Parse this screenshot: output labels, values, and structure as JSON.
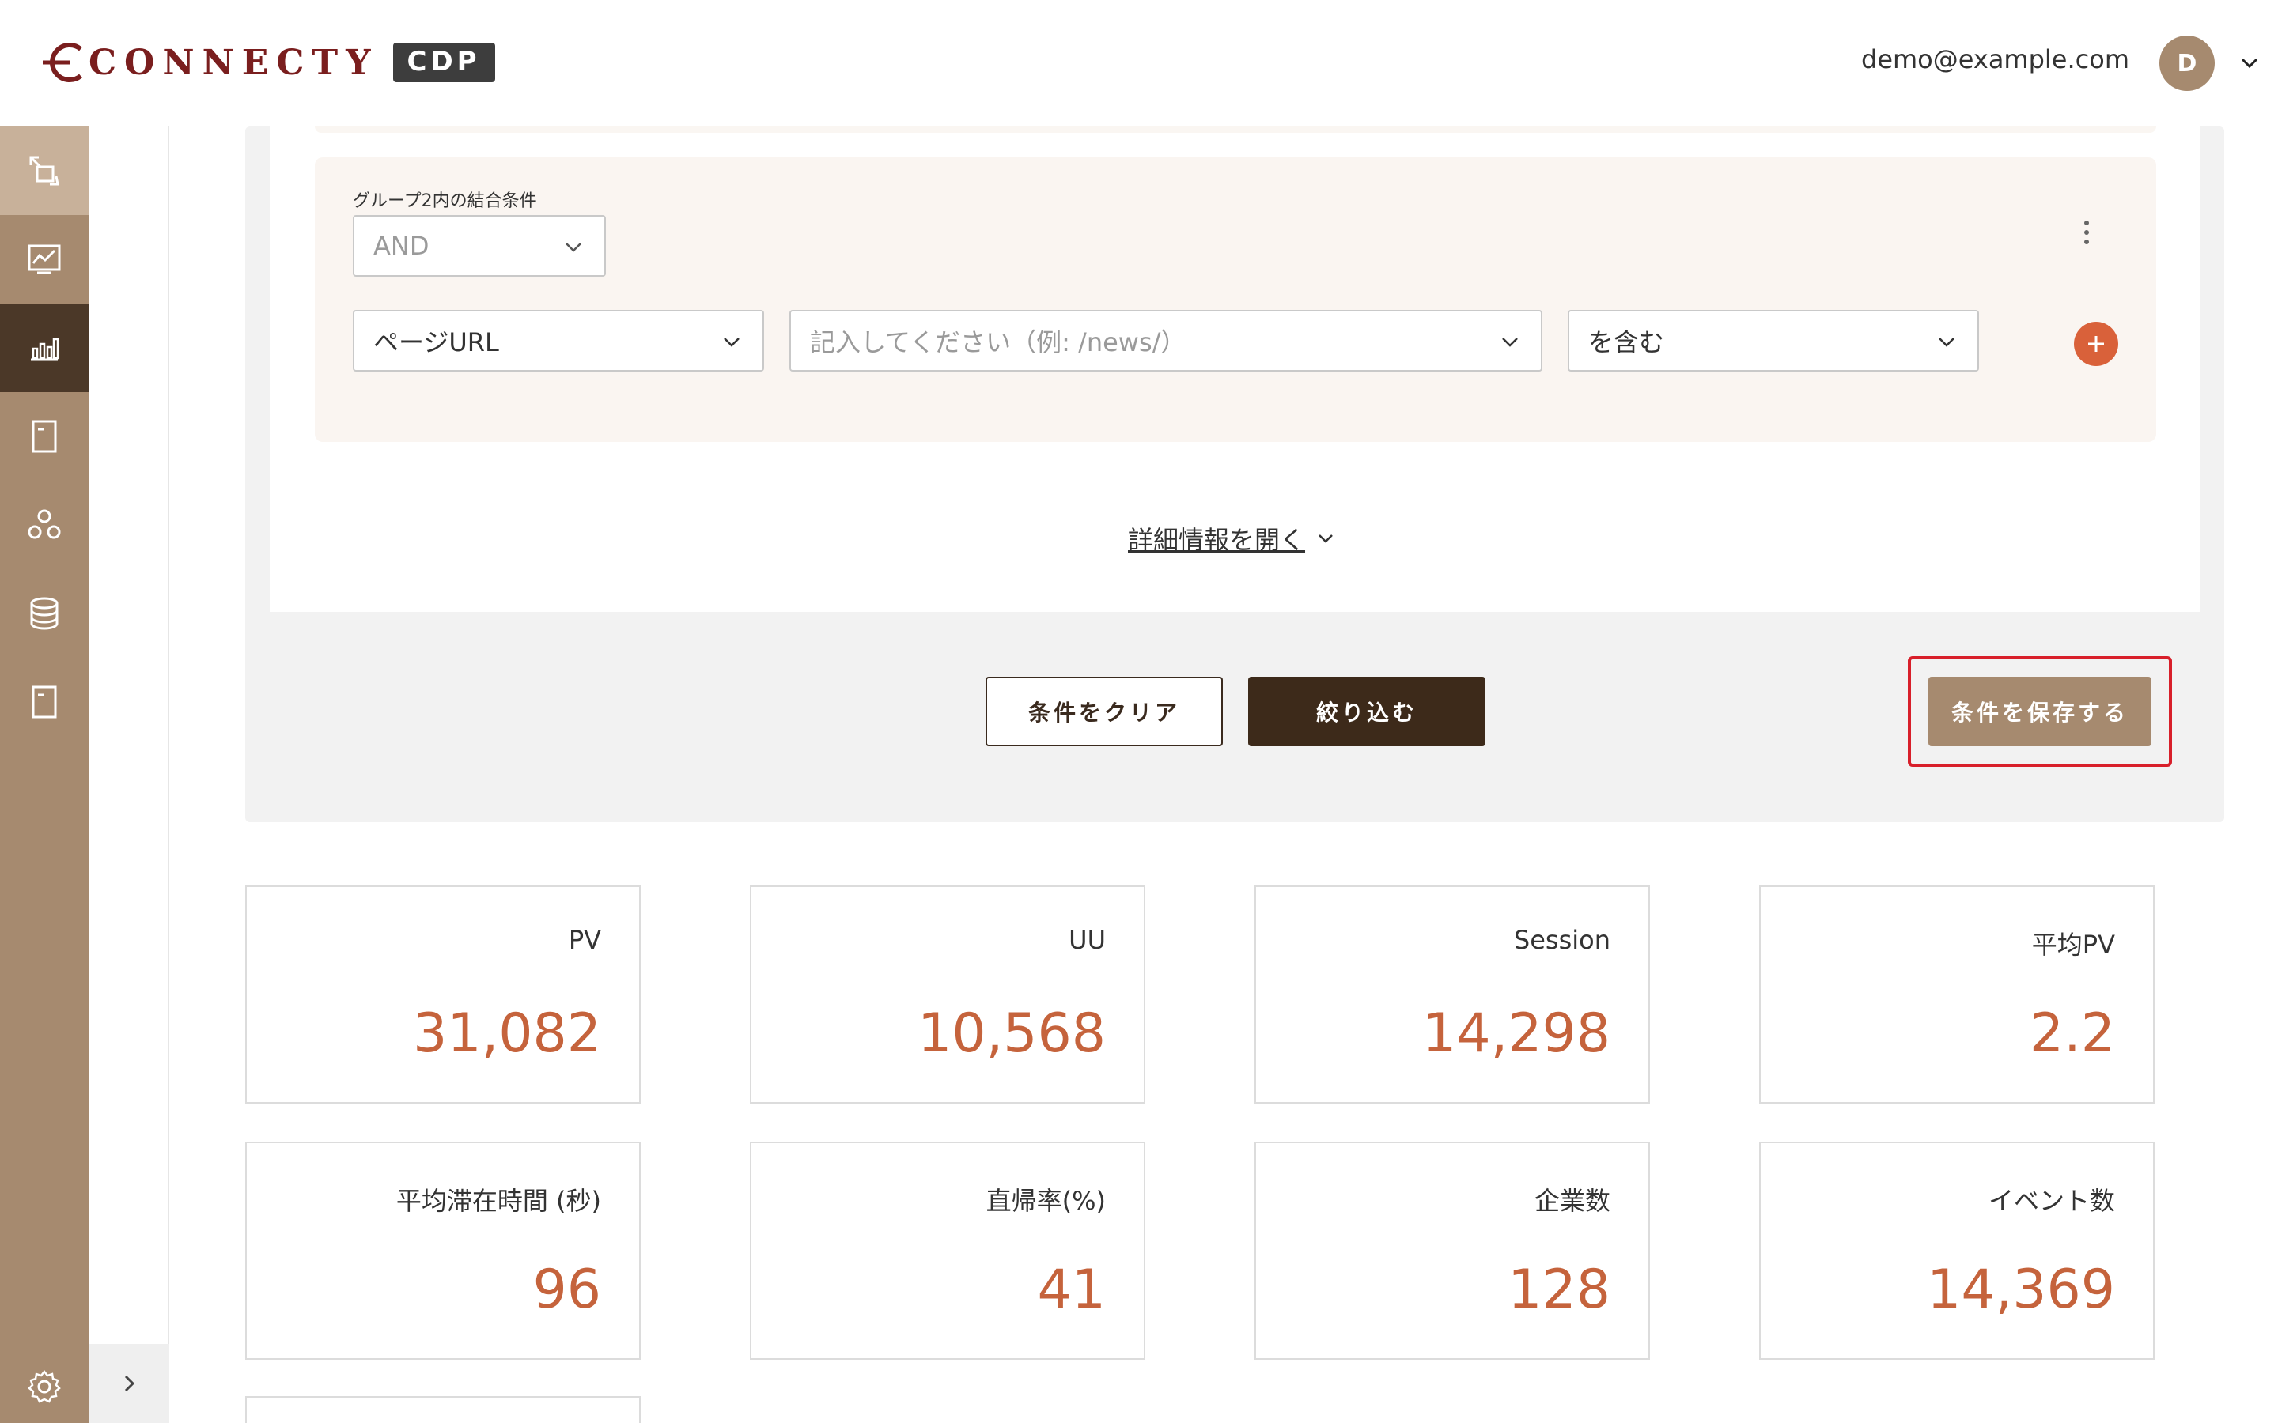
{
  "header": {
    "logo_text": "CONNECTY",
    "logo_badge": "CDP",
    "user_email": "demo@example.com",
    "avatar_initial": "D"
  },
  "sidebar": {
    "items": [
      {
        "icon": "transfer-icon",
        "selected": true
      },
      {
        "icon": "monitor-chart-icon",
        "selected": false
      },
      {
        "icon": "bar-chart-icon",
        "selected": true
      },
      {
        "icon": "document-icon",
        "selected": false
      },
      {
        "icon": "network-icon",
        "selected": false
      },
      {
        "icon": "database-icon",
        "selected": false
      },
      {
        "icon": "document-icon",
        "selected": false
      }
    ],
    "settings_icon": "gear-icon",
    "expand_icon": "chevron-right-icon"
  },
  "filter": {
    "group_label": "グループ2内の結合条件",
    "combine_value": "AND",
    "field_value": "ページURL",
    "input_placeholder": "記入してください（例: /news/）",
    "operator_value": "を含む",
    "details_link": "詳細情報を開く",
    "clear_label": "条件をクリア",
    "apply_label": "絞り込む",
    "save_label": "条件を保存する"
  },
  "metrics": [
    {
      "label": "PV",
      "value": "31,082"
    },
    {
      "label": "UU",
      "value": "10,568"
    },
    {
      "label": "Session",
      "value": "14,298"
    },
    {
      "label": "平均PV",
      "value": "2.2"
    },
    {
      "label": "平均滞在時間 (秒)",
      "value": "96"
    },
    {
      "label": "直帰率(%)",
      "value": "41"
    },
    {
      "label": "企業数",
      "value": "128"
    },
    {
      "label": "イベント数",
      "value": "14,369"
    }
  ],
  "colors": {
    "accent": "#c5633c",
    "sidebar": "#a68a6f",
    "sidebar_dark": "#4b3828",
    "primary_button": "#3d2a1a",
    "highlight": "#d81f2a",
    "add_button": "#d9613a"
  }
}
